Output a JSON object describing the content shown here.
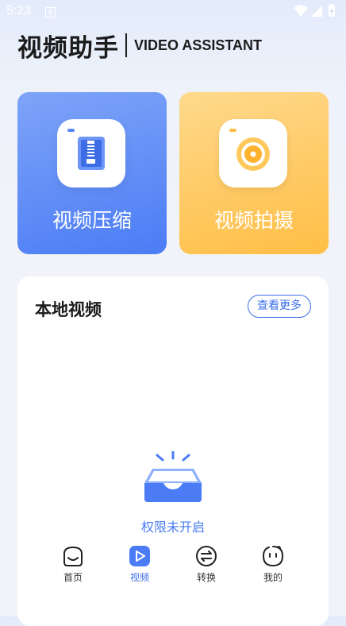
{
  "status_bar": {
    "time": "5:23",
    "notification_letter": "A"
  },
  "header": {
    "title": "视频助手",
    "subtitle": "VIDEO ASSISTANT"
  },
  "features": [
    {
      "label": "视频压缩",
      "icon": "zip-file-icon",
      "color": "#4b7cf5"
    },
    {
      "label": "视频拍摄",
      "icon": "camera-lens-icon",
      "color": "#ffbe45"
    }
  ],
  "local_videos": {
    "title": "本地视频",
    "more_label": "查看更多",
    "empty_text": "权限未开启",
    "empty_icon": "empty-tray-icon"
  },
  "tabs": [
    {
      "label": "首页",
      "icon": "home-face-icon",
      "active": false
    },
    {
      "label": "视频",
      "icon": "play-icon",
      "active": true
    },
    {
      "label": "转换",
      "icon": "convert-arrows-icon",
      "active": false
    },
    {
      "label": "我的",
      "icon": "profile-face-icon",
      "active": false
    }
  ],
  "colors": {
    "accent": "#3a6fe8",
    "title": "#1b1b1b"
  }
}
